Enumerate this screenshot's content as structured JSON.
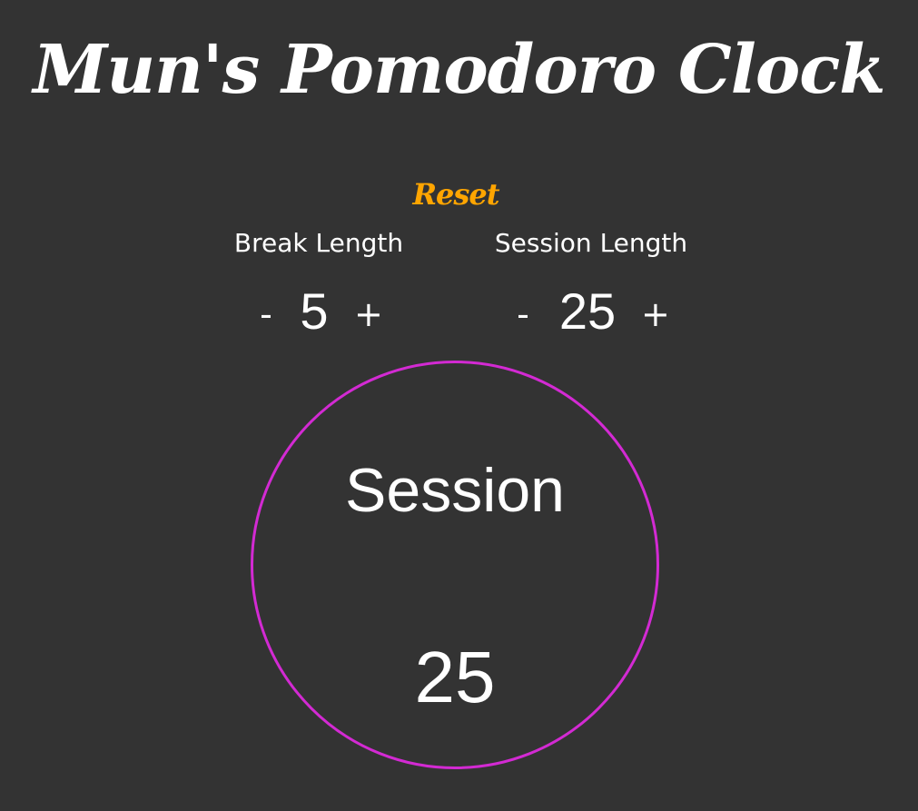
{
  "title": "Mun's Pomodoro Clock",
  "reset_label": "Reset",
  "break": {
    "label": "Break Length",
    "decrement": "-",
    "value": "5",
    "increment": "+"
  },
  "session": {
    "label": "Session Length",
    "decrement": "-",
    "value": "25",
    "increment": "+"
  },
  "clock": {
    "mode_label": "Session",
    "time": "25"
  },
  "colors": {
    "background": "#333333",
    "text": "#ffffff",
    "reset": "#ffa500",
    "clock_ring": "#d32ad3"
  }
}
